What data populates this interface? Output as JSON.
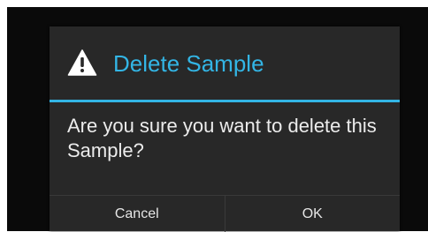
{
  "dialog": {
    "icon": "warning-triangle-icon",
    "title": "Delete Sample",
    "message": "Are you sure you want to delete this Sample?",
    "buttons": {
      "cancel_label": "Cancel",
      "ok_label": "OK"
    }
  },
  "colors": {
    "accent": "#33b5e5",
    "dialog_background": "#282828",
    "screen_background": "#0a0a0a"
  }
}
